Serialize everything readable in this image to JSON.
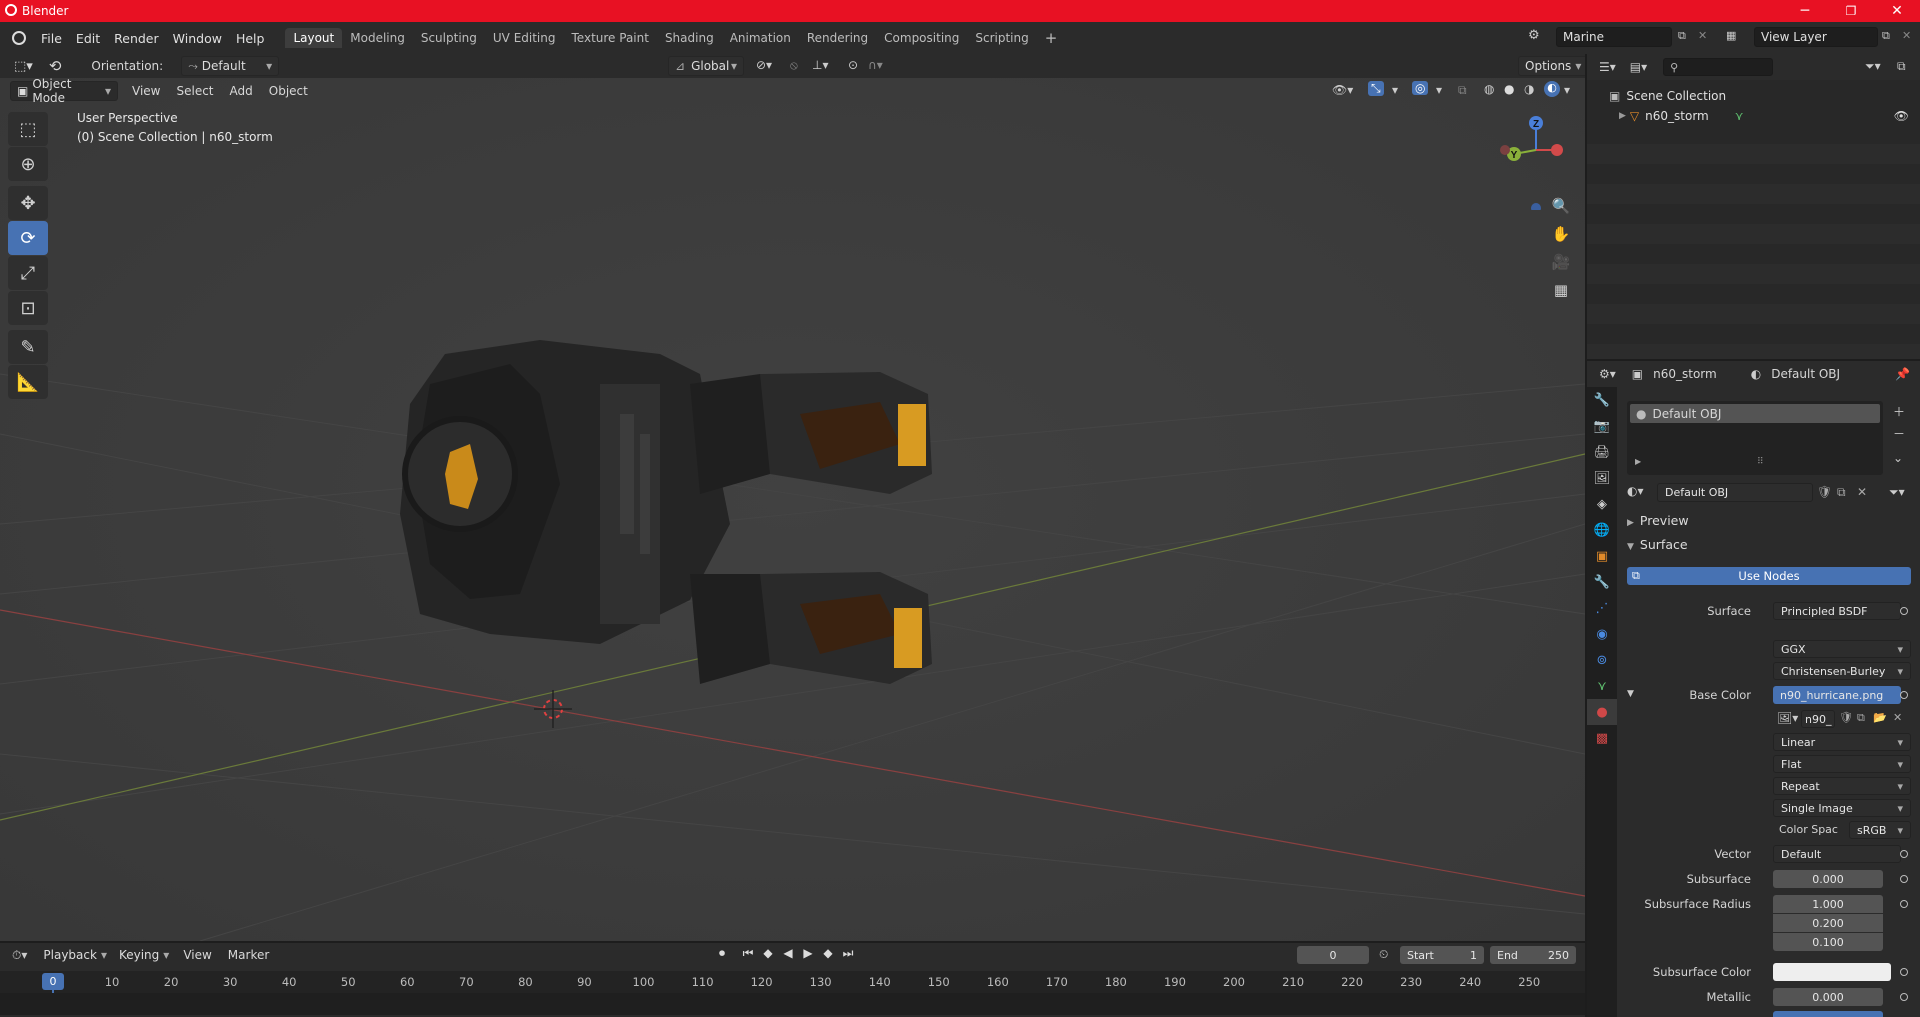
{
  "window": {
    "title": "Blender",
    "minimize": "─",
    "restore": "❐",
    "close": "✕"
  },
  "menubar": {
    "menus": [
      "File",
      "Edit",
      "Render",
      "Window",
      "Help"
    ],
    "workspaces": [
      "Layout",
      "Modeling",
      "Sculpting",
      "UV Editing",
      "Texture Paint",
      "Shading",
      "Animation",
      "Rendering",
      "Compositing",
      "Scripting"
    ],
    "active_workspace": "Layout",
    "add_tab": "+",
    "scene_name": "Marine",
    "view_layer": "View Layer"
  },
  "viewport": {
    "orientation_label": "Orientation:",
    "orientation_value": "Default",
    "transform_space": "Global",
    "options_label": "Options",
    "mode": "Object Mode",
    "menus": [
      "View",
      "Select",
      "Add",
      "Object"
    ],
    "overlay_line1": "User Perspective",
    "overlay_line2": "(0) Scene Collection | n60_storm",
    "gizmo": {
      "z": "Z",
      "y": "Y"
    }
  },
  "outliner": {
    "search_placeholder": "",
    "scene_collection": "Scene Collection",
    "object": "n60_storm"
  },
  "properties": {
    "object_name": "n60_storm",
    "material_name": "Default OBJ",
    "slot_name": "Default OBJ",
    "material_field": "Default OBJ",
    "sections": {
      "preview": "Preview",
      "surface": "Surface"
    },
    "use_nodes": "Use Nodes",
    "rows": {
      "surface_label": "Surface",
      "surface_value": "Principled BSDF",
      "distribution": "GGX",
      "subsurface_method": "Christensen-Burley",
      "base_color_label": "Base Color",
      "base_color_value": "n90_hurricane.png",
      "image_name": "n90_",
      "interpolation": "Linear",
      "projection": "Flat",
      "extension": "Repeat",
      "source": "Single Image",
      "color_space_label": "Color Spac",
      "color_space_value": "sRGB",
      "vector_label": "Vector",
      "vector_value": "Default",
      "subsurface_label": "Subsurface",
      "subsurface_value": "0.000",
      "subsurface_radius_label": "Subsurface Radius",
      "subsurface_radius": [
        "1.000",
        "0.200",
        "0.100"
      ],
      "subsurface_color_label": "Subsurface Color",
      "metallic_label": "Metallic",
      "metallic_value": "0.000"
    }
  },
  "timeline": {
    "menus": [
      "Playback",
      "Keying",
      "View",
      "Marker"
    ],
    "current_frame": "0",
    "start_label": "Start",
    "start_value": "1",
    "end_label": "End",
    "end_value": "250",
    "ruler_current": "0",
    "ticks": [
      "10",
      "20",
      "30",
      "40",
      "50",
      "60",
      "70",
      "80",
      "90",
      "100",
      "110",
      "120",
      "130",
      "140",
      "150",
      "160",
      "170",
      "180",
      "190",
      "200",
      "210",
      "220",
      "230",
      "240",
      "250"
    ]
  },
  "colors": {
    "title_bar": "#e81123",
    "accent": "#4772b3",
    "viewport_bg": "#3d3d3d"
  }
}
